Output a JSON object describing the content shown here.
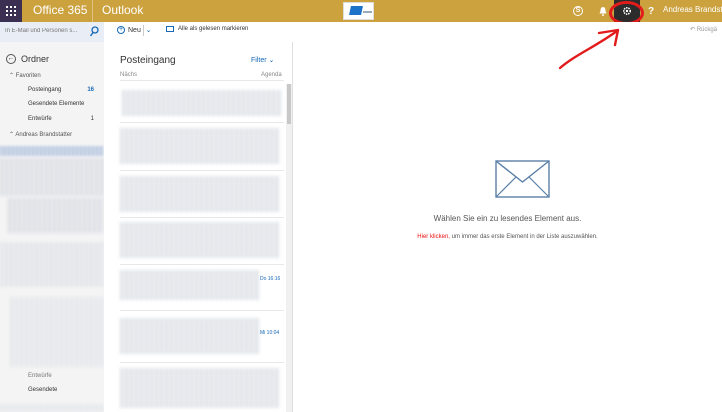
{
  "suitebar": {
    "brand": "Office 365",
    "app": "Outlook",
    "username": "Andreas Brandst",
    "icons": [
      "waffle-icon",
      "skype-icon",
      "bell-icon",
      "gear-icon",
      "help-icon"
    ],
    "help_label": "?",
    "bar_color": "#cca23f",
    "waffle_color": "#3b2f52",
    "highlight_color": "#e21b1b"
  },
  "commandbar": {
    "search_placeholder": "In E-Mail und Personen s...",
    "new_label": "Neu",
    "mark_read_label": "Alle als gelesen markieren",
    "undo_label": "Rückgä"
  },
  "leftnav": {
    "title": "Ordner",
    "favorites_label": "Favoriten",
    "favorites": [
      {
        "label": "Posteingang",
        "count": "16"
      },
      {
        "label": "Gesendete Elemente",
        "count": ""
      },
      {
        "label": "Entwürfe",
        "count": "1"
      }
    ],
    "account_label": "Andreas Brandstatter",
    "bottom_items": [
      "Entwürfe",
      "Gesendete"
    ]
  },
  "messagelist": {
    "title": "Posteingang",
    "filter_label": "Filter",
    "header_left": "Nächs",
    "header_right": "Agenda",
    "dates": [
      "Do 16:16",
      "Mi 10:04"
    ]
  },
  "reading": {
    "prompt": "Wählen Sie ein zu lesendes Element aus.",
    "hint_link": "Hier klicken,",
    "hint_rest": " um immer das erste Element in der Liste auszuwählen."
  }
}
